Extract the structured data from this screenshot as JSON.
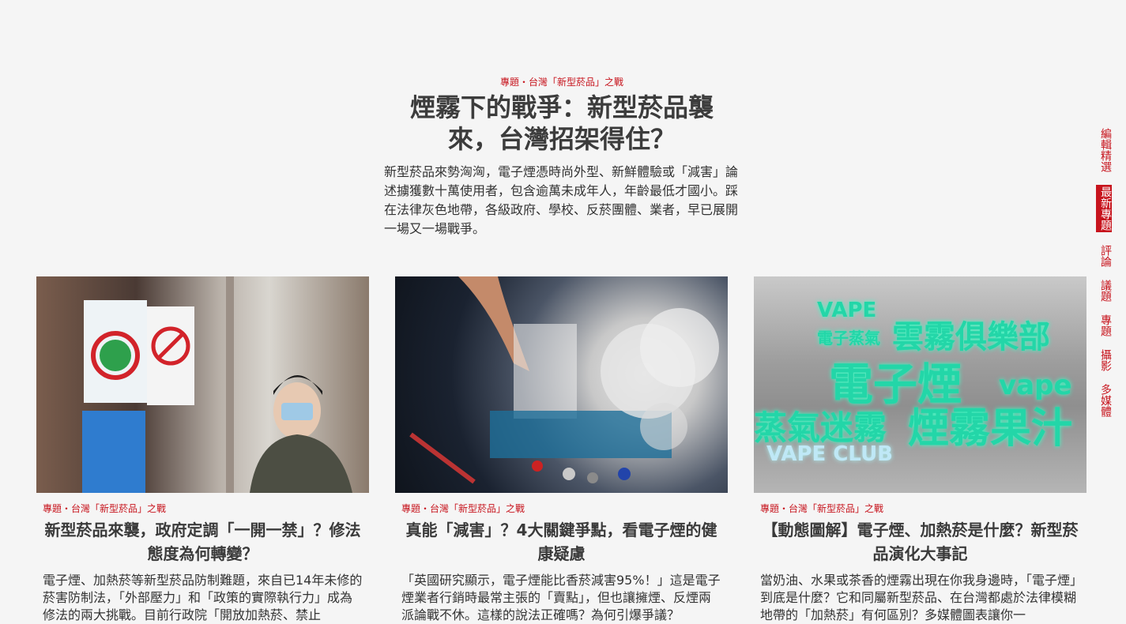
{
  "hero": {
    "kicker": "專題・台灣「新型菸品」之戰",
    "title": "煙霧下的戰爭：新型菸品襲來，台灣招架得住？",
    "description": "新型菸品來勢洶洶，電子煙憑時尚外型、新鮮體驗或「減害」論述擄獲數十萬使用者，包含逾萬未成年人，年齡最低才國小。踩在法律灰色地帶，各級政府、學校、反菸團體、業者，早已展開一場又一場戰爭。"
  },
  "cards": [
    {
      "kicker": "專題・台灣「新型菸品」之戰",
      "title": "新型菸品來襲，政府定調「一開一禁」？修法態度為何轉變？",
      "description": "電子煙、加熱菸等新型菸品防制難題，來自已14年未修的菸害防制法，「外部壓力」和「政策的實際執行力」成為修法的兩大挑戰。目前行政院「開放加熱菸、禁止"
    },
    {
      "kicker": "專題・台灣「新型菸品」之戰",
      "title": "真能「減害」？4大關鍵爭點，看電子煙的健康疑慮",
      "description": "「英國研究顯示，電子煙能比香菸減害95%！」這是電子煙業者行銷時最常主張的「賣點」，但也讓擁煙、反煙兩派論戰不休。這樣的說法正確嗎？為何引爆爭議？"
    },
    {
      "kicker": "專題・台灣「新型菸品」之戰",
      "title": "【動態圖解】電子煙、加熱菸是什麼？新型菸品演化大事記",
      "description": "當奶油、水果或茶香的煙霧出現在你我身邊時，「電子煙」到底是什麼？它和同屬新型菸品、在台灣都處於法律模糊地帶的「加熱菸」有何區別？多媒體圖表讓你一"
    }
  ],
  "image3_text": {
    "l1": "VAPE",
    "l2": "電子蒸氣",
    "l3": "雲霧俱樂部",
    "l4": "電子煙",
    "l5": "vape",
    "l6": "蒸氣迷霧",
    "l7": "煙霧果汁",
    "l8": "VAPE CLUB"
  },
  "side_nav": [
    "編輯精選",
    "最新專題",
    "評論",
    "議題",
    "專題",
    "攝影",
    "多媒體"
  ],
  "colors": {
    "accent": "#c7141d",
    "background": "#f5f5f5"
  }
}
